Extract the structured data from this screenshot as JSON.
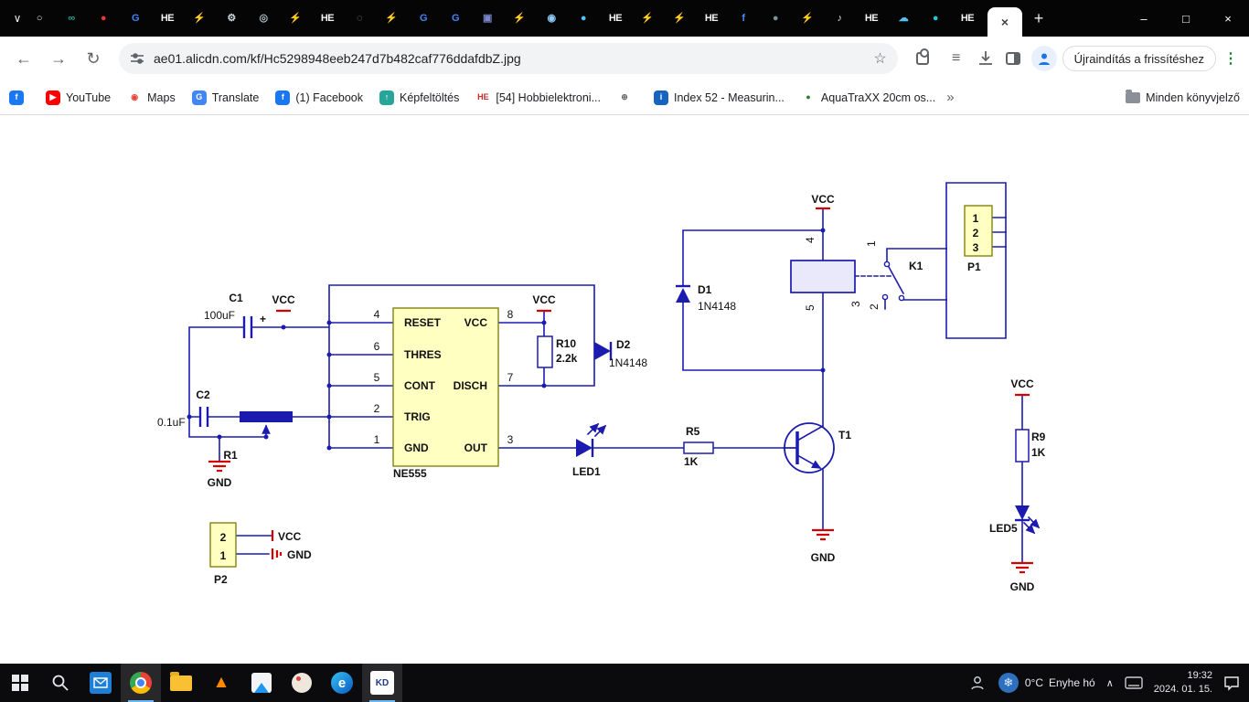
{
  "browser": {
    "url": "ae01.alicdn.com/kf/Hc5298948eeb247d7b482caf776ddafdbZ.jpg",
    "update_button": "Újraindítás a frissítéshez",
    "all_bookmarks_label": "Minden könyvjelző",
    "tabs": [
      {
        "glyph": "○",
        "color": "#e8eaed"
      },
      {
        "glyph": "∞",
        "color": "#26a69a"
      },
      {
        "glyph": "●",
        "color": "#e53935"
      },
      {
        "glyph": "G",
        "color": "#4285f4"
      },
      {
        "glyph": "HE",
        "color": "#f5f5f5"
      },
      {
        "glyph": "⚡",
        "color": "#fbc02d"
      },
      {
        "glyph": "⚙",
        "color": "#cfd8dc"
      },
      {
        "glyph": "◎",
        "color": "#b0bec5"
      },
      {
        "glyph": "⚡",
        "color": "#fbc02d"
      },
      {
        "glyph": "HE",
        "color": "#f5f5f5"
      },
      {
        "glyph": "◌",
        "color": "#90a4ae"
      },
      {
        "glyph": "⚡",
        "color": "#fbc02d"
      },
      {
        "glyph": "G",
        "color": "#4285f4"
      },
      {
        "glyph": "G",
        "color": "#4285f4"
      },
      {
        "glyph": "▣",
        "color": "#7986cb"
      },
      {
        "glyph": "⚡",
        "color": "#fbc02d"
      },
      {
        "glyph": "◉",
        "color": "#90caf9"
      },
      {
        "glyph": "●",
        "color": "#4fc3f7"
      },
      {
        "glyph": "HE",
        "color": "#f5f5f5"
      },
      {
        "glyph": "⚡",
        "color": "#fbc02d"
      },
      {
        "glyph": "⚡",
        "color": "#fbc02d"
      },
      {
        "glyph": "HE",
        "color": "#f5f5f5"
      },
      {
        "glyph": "f",
        "color": "#4e8cf5"
      },
      {
        "glyph": "●",
        "color": "#78909c"
      },
      {
        "glyph": "⚡",
        "color": "#fbc02d"
      },
      {
        "glyph": "♪",
        "color": "#e0e0e0"
      },
      {
        "glyph": "HE",
        "color": "#f5f5f5"
      },
      {
        "glyph": "☁",
        "color": "#4fc3f7"
      },
      {
        "glyph": "●",
        "color": "#26c6da"
      },
      {
        "glyph": "HE",
        "color": "#f5f5f5"
      }
    ],
    "bookmarks": [
      {
        "label": "",
        "glyph": "f",
        "color": "#ffffff",
        "bg": "#1877f2"
      },
      {
        "label": "YouTube",
        "glyph": "▶",
        "color": "#ffffff",
        "bg": "#ff0000"
      },
      {
        "label": "Maps",
        "glyph": "◉",
        "color": "#ea4335",
        "bg": "transparent"
      },
      {
        "label": "Translate",
        "glyph": "G",
        "color": "#ffffff",
        "bg": "#4285f4"
      },
      {
        "label": "(1) Facebook",
        "glyph": "f",
        "color": "#ffffff",
        "bg": "#1877f2"
      },
      {
        "label": "Képfeltöltés",
        "glyph": "↑",
        "color": "#ffffff",
        "bg": "#26a69a"
      },
      {
        "label": "[54] Hobbielektroni...",
        "glyph": "HE",
        "color": "#c62828",
        "bg": "transparent"
      },
      {
        "label": "",
        "glyph": "⊕",
        "color": "#5f6368",
        "bg": "transparent"
      },
      {
        "label": "Index 52 - Measurin...",
        "glyph": "i",
        "color": "#ffffff",
        "bg": "#1565c0"
      },
      {
        "label": "AquaTraXX 20cm os...",
        "glyph": "●",
        "color": "#2e7d32",
        "bg": "transparent"
      }
    ]
  },
  "schematic": {
    "power": {
      "vcc": "VCC",
      "gnd": "GND"
    },
    "c1": {
      "ref": "C1",
      "val": "100uF",
      "plus": "+"
    },
    "c2": {
      "ref": "C2",
      "val": "0.1uF"
    },
    "r1": {
      "ref": "R1"
    },
    "ic": {
      "name": "NE555",
      "left_pins": [
        {
          "n": "4",
          "t": "RESET"
        },
        {
          "n": "6",
          "t": "THRES"
        },
        {
          "n": "5",
          "t": "CONT"
        },
        {
          "n": "2",
          "t": "TRIG"
        },
        {
          "n": "1",
          "t": "GND"
        }
      ],
      "right_pins": [
        {
          "n": "8",
          "t": "VCC"
        },
        {
          "n": "7",
          "t": "DISCH"
        },
        {
          "n": "3",
          "t": "OUT"
        }
      ]
    },
    "r10": {
      "ref": "R10",
      "val": "2.2k"
    },
    "d2": {
      "ref": "D2",
      "val": "1N4148"
    },
    "d1": {
      "ref": "D1",
      "val": "1N4148"
    },
    "relay": {
      "pin_top": "4",
      "pin_bottom": "5"
    },
    "k1": {
      "ref": "K1",
      "pin_a": "1",
      "pin_b": "3",
      "pin_c": "2"
    },
    "p1": {
      "ref": "P1",
      "pins": [
        "1",
        "2",
        "3"
      ]
    },
    "led1": {
      "ref": "LED1"
    },
    "r5": {
      "ref": "R5",
      "val": "1K"
    },
    "t1": {
      "ref": "T1"
    },
    "r9": {
      "ref": "R9",
      "val": "1K"
    },
    "led5": {
      "ref": "LED5"
    },
    "p2": {
      "ref": "P2",
      "pins": [
        "2",
        "1"
      ]
    }
  },
  "taskbar": {
    "kd_label": "KD",
    "weather_temp": "0°C",
    "weather_cond": "Enyhe hó",
    "time": "19:32",
    "date": "2024. 01. 15."
  }
}
